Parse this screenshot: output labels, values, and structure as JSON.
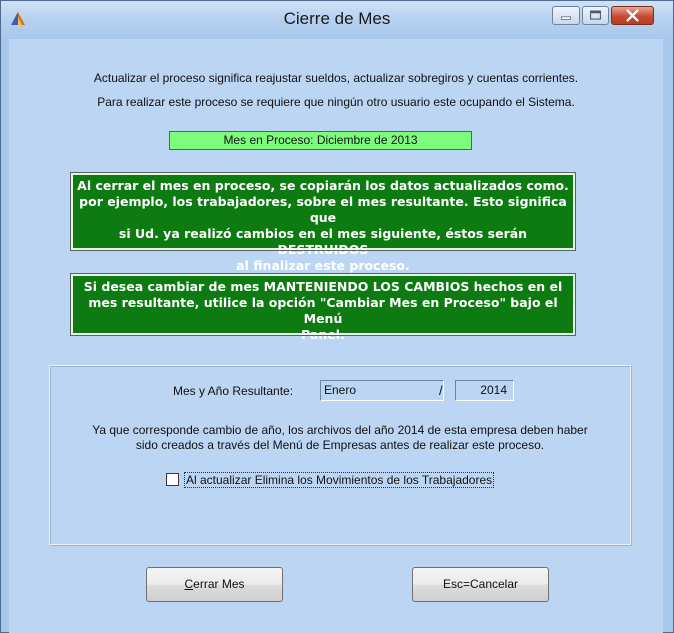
{
  "window": {
    "title": "Cierre de Mes",
    "controls": [
      "minimize-icon",
      "maximize-icon",
      "close-icon"
    ]
  },
  "intro": {
    "line1": "Actualizar el proceso significa reajustar sueldos, actualizar sobregiros y cuentas corrientes.",
    "line2": "Para realizar este proceso se requiere que ningún otro usuario este ocupando el Sistema."
  },
  "month_in_process": "Mes en Proceso: Diciembre de 2013",
  "warning_box": {
    "lines": [
      "Al cerrar el mes en proceso, se copiarán los datos actualizados como.",
      "por ejemplo, los trabajadores, sobre el mes resultante. Esto significa que",
      "si Ud. ya realizó cambios en el mes siguiente, éstos serán DESTRUIDOS",
      "al finalizar este proceso."
    ]
  },
  "info_box": {
    "lines": [
      "Si desea cambiar de mes MANTENIENDO LOS CAMBIOS hechos en el",
      "mes resultante, utilice la opción \"Cambiar Mes en Proceso\" bajo el Menú",
      "Panel."
    ]
  },
  "result": {
    "label": "Mes y Año Resultante:",
    "month": "Enero",
    "separator": "/",
    "year": "2014"
  },
  "note": {
    "line1": "Ya que corresponde cambio de año, los archivos del año 2014 de esta empresa deben haber",
    "line2": "sido creados a través del Menú de Empresas antes de realizar este proceso."
  },
  "checkbox": {
    "label": "Al actualizar Elimina los Movimientos de los Trabajadores",
    "checked": false
  },
  "buttons": {
    "cerrar_prefix": "C",
    "cerrar_rest": "errar Mes",
    "cancel": "Esc=Cancelar"
  },
  "colors": {
    "window_bg": "#bcd5f2",
    "month_box": "#7dfb7d",
    "green_box": "#0d7b12",
    "close_button": "#c74a33"
  }
}
